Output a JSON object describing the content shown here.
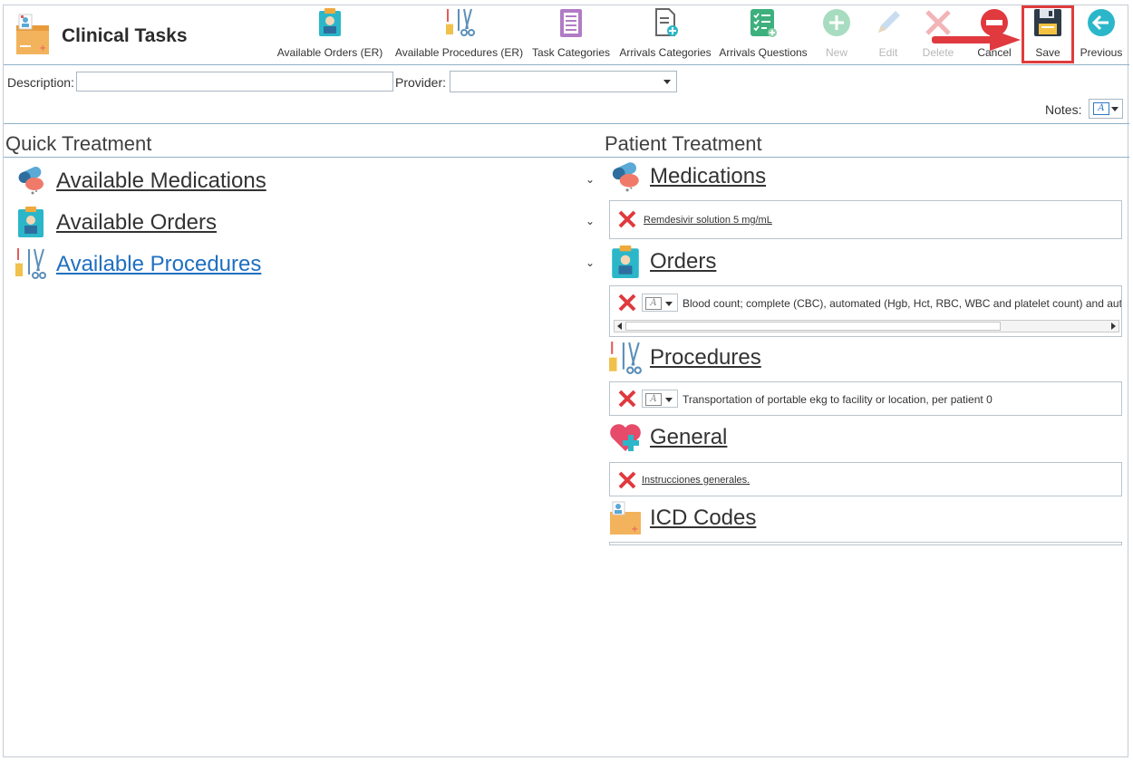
{
  "app": {
    "title": "Clinical Tasks"
  },
  "toolbar": {
    "available_orders": "Available Orders (ER)",
    "available_procedures": "Available Procedures (ER)",
    "task_categories": "Task Categories",
    "arrivals_categories": "Arrivals Categories",
    "arrivals_questions": "Arrivals Questions",
    "new": "New",
    "edit": "Edit",
    "delete": "Delete",
    "cancel": "Cancel",
    "save": "Save",
    "previous": "Previous"
  },
  "filters": {
    "description_label": "Description:",
    "description_value": "",
    "provider_label": "Provider:",
    "provider_value": "",
    "notes_label": "Notes:"
  },
  "quick_treatment": {
    "title": "Quick Treatment",
    "items": [
      {
        "label": "Available Medications"
      },
      {
        "label": "Available Orders"
      },
      {
        "label": "Available Procedures"
      }
    ]
  },
  "patient_treatment": {
    "title": "Patient Treatment",
    "sections": {
      "medications": {
        "title": "Medications",
        "entry": "Remdesivir solution 5 mg/mL"
      },
      "orders": {
        "title": "Orders",
        "entry": "Blood count; complete (CBC), automated (Hgb, Hct, RBC, WBC and platelet count) and automated differential WBC count"
      },
      "procedures": {
        "title": "Procedures",
        "entry": "Transportation of portable ekg to facility or location, per patient 0"
      },
      "general": {
        "title": "General",
        "entry": "Instrucciones generales."
      },
      "icd": {
        "title": "ICD Codes"
      }
    }
  },
  "colors": {
    "accent": "#1f6fc1",
    "highlight": "#e03c3c",
    "delete_x": "#e0393e"
  }
}
